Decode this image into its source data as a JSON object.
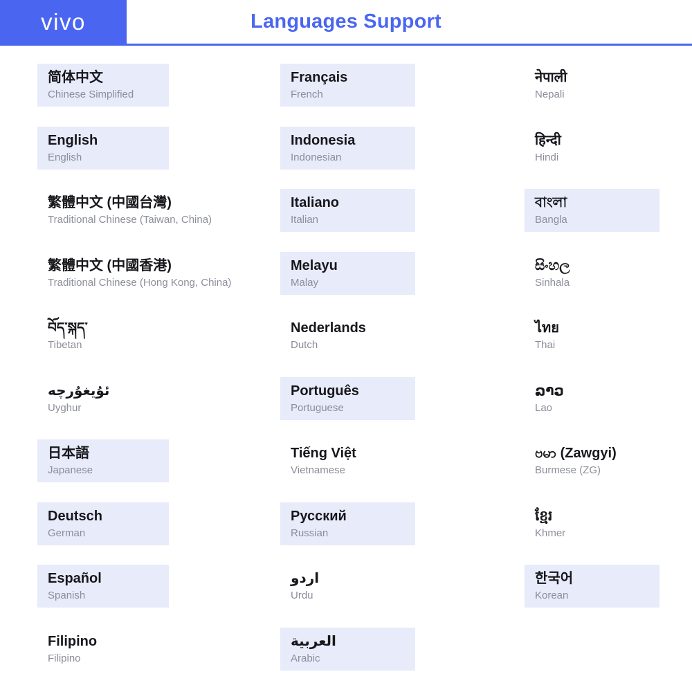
{
  "header": {
    "logo_text": "vivo",
    "title": "Languages Support",
    "brand_color": "#4a66f0",
    "logo_bg_color": "#4a66f0",
    "logo_text_color": "#ffffff",
    "rule_color": "#4a66f0"
  },
  "styles": {
    "highlight_color": "#e7ebfa",
    "native_text_color": "#17171c",
    "english_text_color": "#8b8e9a",
    "page_background": "#ffffff"
  },
  "columns": [
    {
      "name": "column-1",
      "items": [
        {
          "native": "简体中文",
          "english": "Chinese Simplified",
          "highlight": true,
          "rtl": false
        },
        {
          "native": "English",
          "english": "English",
          "highlight": true,
          "rtl": false
        },
        {
          "native": "繁體中文 (中國台灣)",
          "english": "Traditional Chinese (Taiwan, China)",
          "highlight": false,
          "rtl": false
        },
        {
          "native": "繁體中文 (中國香港)",
          "english": "Traditional Chinese (Hong Kong, China)",
          "highlight": false,
          "rtl": false
        },
        {
          "native": "བོད་སྐད་",
          "english": "Tibetan",
          "highlight": false,
          "rtl": false
        },
        {
          "native": "ئۇيغۇرچە",
          "english": "Uyghur",
          "highlight": false,
          "rtl": true
        },
        {
          "native": "日本語",
          "english": "Japanese",
          "highlight": true,
          "rtl": false
        },
        {
          "native": "Deutsch",
          "english": "German",
          "highlight": true,
          "rtl": false
        },
        {
          "native": "Español",
          "english": "Spanish",
          "highlight": true,
          "rtl": false
        },
        {
          "native": "Filipino",
          "english": "Filipino",
          "highlight": false,
          "rtl": false
        }
      ]
    },
    {
      "name": "column-2",
      "items": [
        {
          "native": "Français",
          "english": "French",
          "highlight": true,
          "rtl": false
        },
        {
          "native": "Indonesia",
          "english": "Indonesian",
          "highlight": true,
          "rtl": false
        },
        {
          "native": "Italiano",
          "english": "Italian",
          "highlight": true,
          "rtl": false
        },
        {
          "native": "Melayu",
          "english": "Malay",
          "highlight": true,
          "rtl": false
        },
        {
          "native": "Nederlands",
          "english": "Dutch",
          "highlight": false,
          "rtl": false
        },
        {
          "native": "Português",
          "english": "Portuguese",
          "highlight": true,
          "rtl": false
        },
        {
          "native": "Tiếng Việt",
          "english": "Vietnamese",
          "highlight": false,
          "rtl": false
        },
        {
          "native": "Русский",
          "english": "Russian",
          "highlight": true,
          "rtl": false
        },
        {
          "native": "اردو",
          "english": "Urdu",
          "highlight": false,
          "rtl": true
        },
        {
          "native": "العربية",
          "english": "Arabic",
          "highlight": true,
          "rtl": true
        }
      ]
    },
    {
      "name": "column-3",
      "items": [
        {
          "native": "नेपाली",
          "english": "Nepali",
          "highlight": false,
          "rtl": false
        },
        {
          "native": "हिन्दी",
          "english": "Hindi",
          "highlight": false,
          "rtl": false
        },
        {
          "native": "বাংলা",
          "english": "Bangla",
          "highlight": true,
          "rtl": false
        },
        {
          "native": "සිංහල",
          "english": "Sinhala",
          "highlight": false,
          "rtl": false
        },
        {
          "native": "ไทย",
          "english": "Thai",
          "highlight": false,
          "rtl": false
        },
        {
          "native": "ລາວ",
          "english": "Lao",
          "highlight": false,
          "rtl": false
        },
        {
          "native": "ဗမာ (Zawgyi)",
          "english": "Burmese (ZG)",
          "highlight": false,
          "rtl": false
        },
        {
          "native": "ខ្មែរ",
          "english": "Khmer",
          "highlight": false,
          "rtl": false
        },
        {
          "native": "한국어",
          "english": "Korean",
          "highlight": true,
          "rtl": false
        }
      ]
    }
  ]
}
